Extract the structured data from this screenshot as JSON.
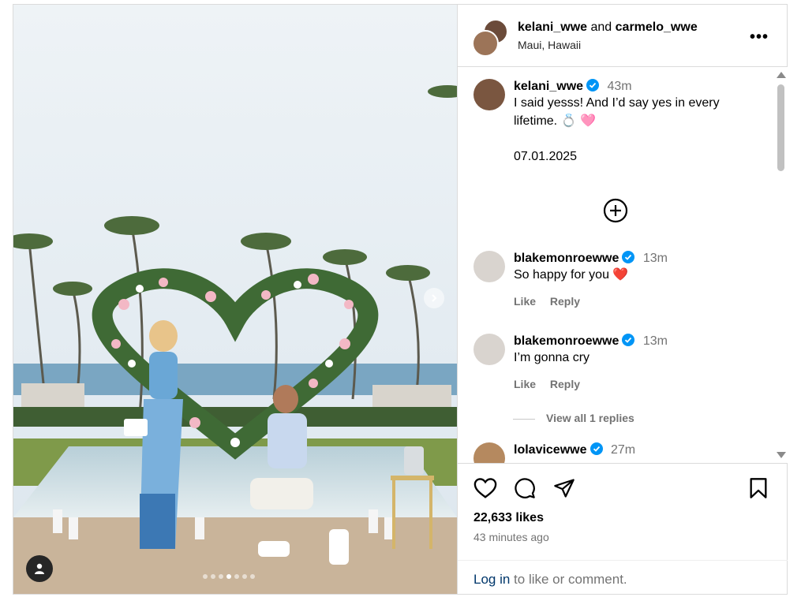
{
  "post": {
    "header": {
      "author1": "kelani_wwe",
      "and_text": "and",
      "author2": "carmelo_wwe",
      "location": "Maui, Hawaii",
      "more_icon": "more-horizontal-icon"
    },
    "caption": {
      "username": "kelani_wwe",
      "time": "43m",
      "text_line1": "I said yesss! And I’d say yes in every",
      "text_line2": "lifetime. 💍 🩷",
      "date": "07.01.2025"
    },
    "comments": [
      {
        "username": "blakemonroewwe",
        "time": "13m",
        "text": "So happy for you ❤️",
        "like": "Like",
        "reply": "Reply"
      },
      {
        "username": "blakemonroewwe",
        "time": "13m",
        "text": "I’m gonna cry",
        "like": "Like",
        "reply": "Reply",
        "view_replies": "View all 1 replies"
      },
      {
        "username": "lolavicewwe",
        "time": "27m",
        "text": ""
      }
    ],
    "footer": {
      "likes": "22,633 likes",
      "time_ago": "43 minutes ago",
      "login_link": "Log in",
      "login_rest": " to like or comment."
    },
    "carousel": {
      "slides": 7,
      "active_index": 3
    },
    "colors": {
      "verified": "#0095f6",
      "link": "#00376b",
      "muted": "#737373",
      "border": "#dbdbdb"
    }
  }
}
